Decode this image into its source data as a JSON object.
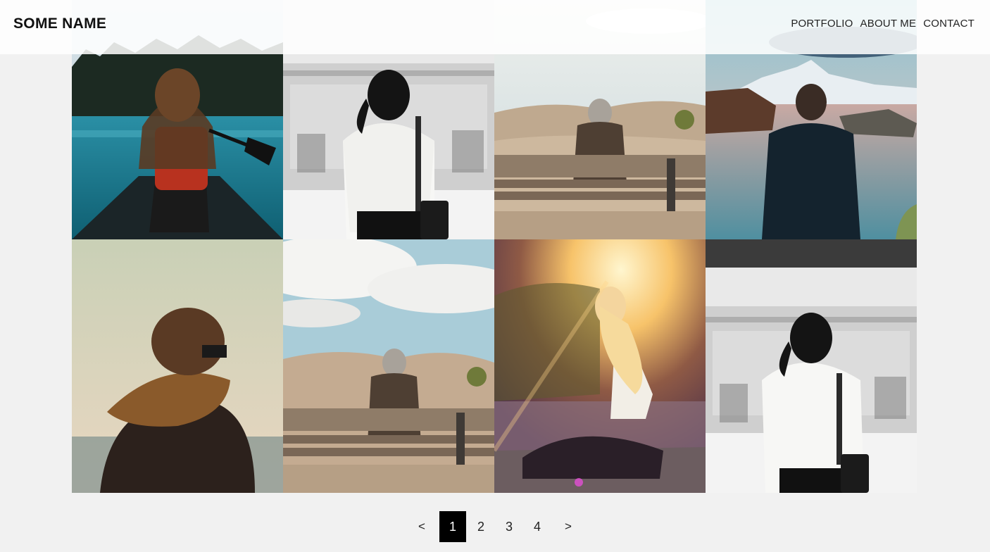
{
  "header": {
    "brand": "SOME NAME",
    "nav": [
      {
        "label": "PORTFOLIO"
      },
      {
        "label": "ABOUT ME"
      },
      {
        "label": "CONTACT"
      }
    ]
  },
  "gallery": {
    "photos": [
      {
        "subject": "woman paddling a canoe on a lake"
      },
      {
        "subject": "woman in white sweater watching a passing train"
      },
      {
        "subject": "elderly person sitting on a bench in the dunes"
      },
      {
        "subject": "man in blue jacket facing mountain lake"
      },
      {
        "subject": "woman with scarf and sunglasses by the sea"
      },
      {
        "subject": "elderly person on a bench under cloudy sky"
      },
      {
        "subject": "blonde woman sitting in the sunset light"
      },
      {
        "subject": "woman in white sweater watching a passing train"
      }
    ]
  },
  "pagination": {
    "prev": "<",
    "next": ">",
    "pages": [
      "1",
      "2",
      "3",
      "4"
    ],
    "current": "1"
  },
  "colors": {
    "background": "#f1f1f1",
    "active_page_bg": "#000000",
    "active_page_text": "#ffffff"
  }
}
